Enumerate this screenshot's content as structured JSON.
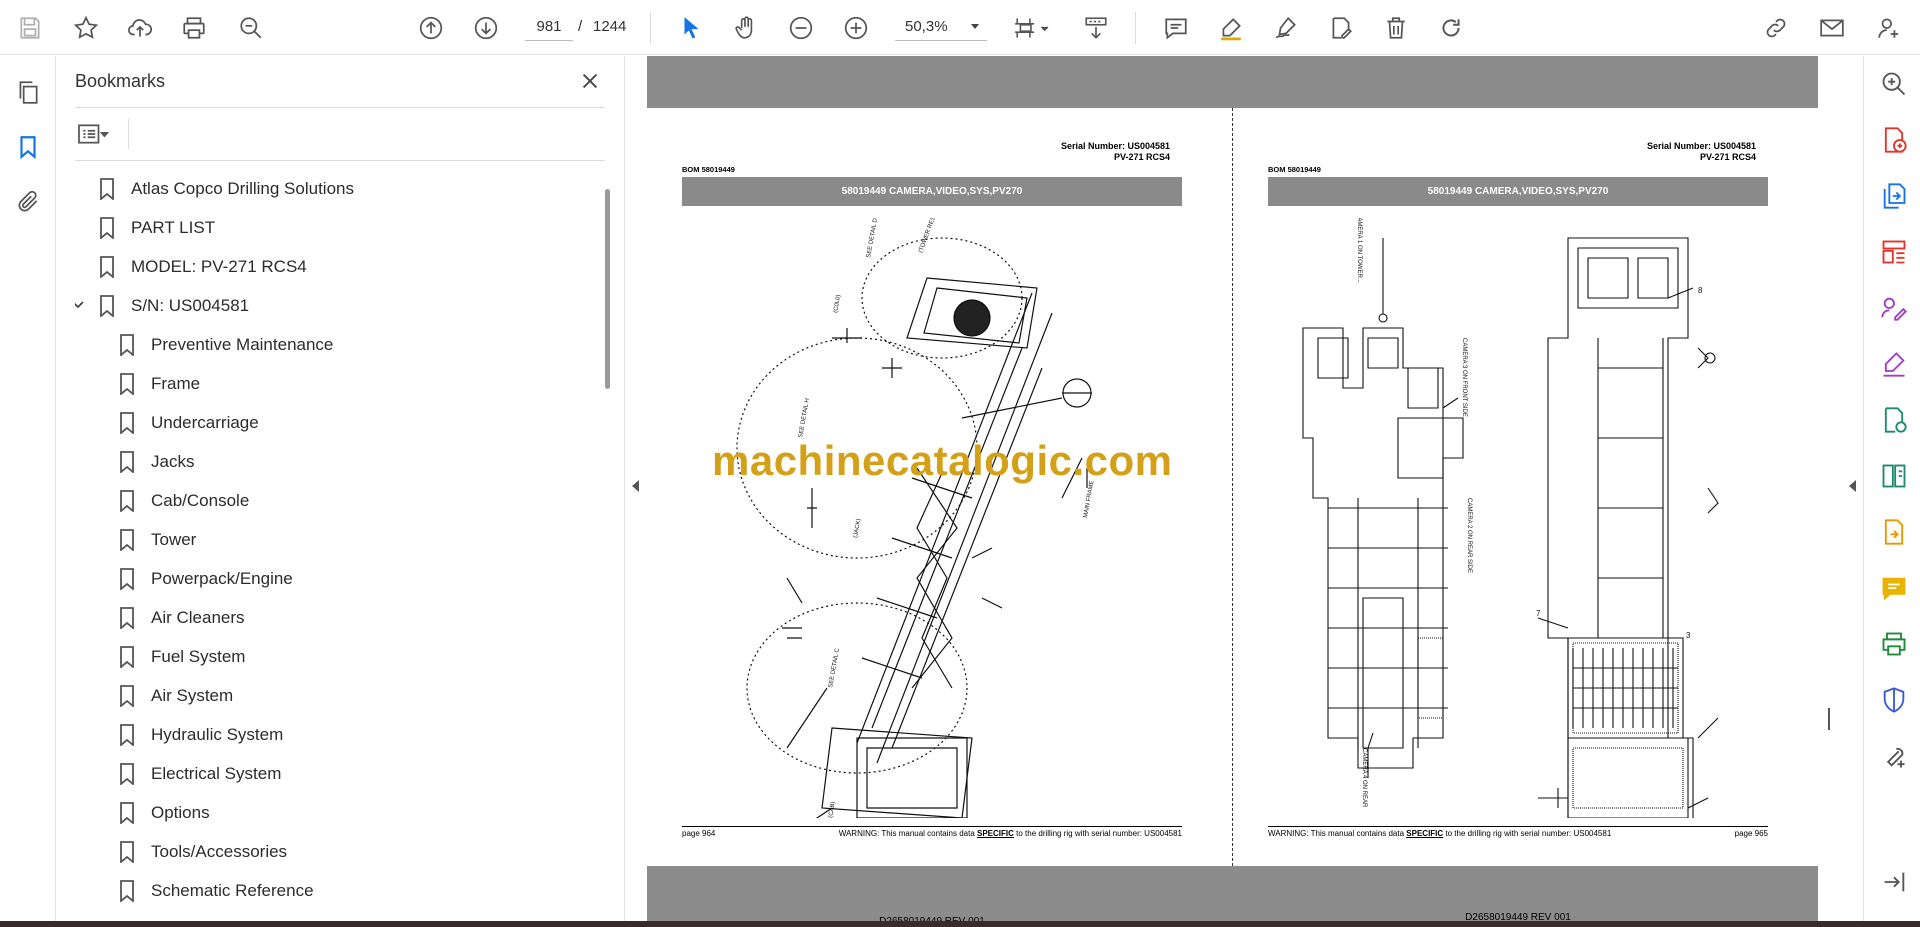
{
  "toolbar": {
    "current_page": "981",
    "page_separator": "/",
    "total_pages": "1244",
    "zoom": "50,3%"
  },
  "bookmarks": {
    "title": "Bookmarks",
    "items": [
      {
        "label": "Atlas Copco Drilling Solutions",
        "level": 0
      },
      {
        "label": "PART LIST",
        "level": 0
      },
      {
        "label": "MODEL: PV-271 RCS4",
        "level": 0
      },
      {
        "label": "S/N: US004581",
        "level": 0,
        "expanded": true
      },
      {
        "label": "Preventive Maintenance",
        "level": 1
      },
      {
        "label": "Frame",
        "level": 1
      },
      {
        "label": "Undercarriage",
        "level": 1
      },
      {
        "label": "Jacks",
        "level": 1
      },
      {
        "label": "Cab/Console",
        "level": 1
      },
      {
        "label": "Tower",
        "level": 1
      },
      {
        "label": "Powerpack/Engine",
        "level": 1
      },
      {
        "label": "Air Cleaners",
        "level": 1
      },
      {
        "label": "Fuel System",
        "level": 1
      },
      {
        "label": "Air System",
        "level": 1
      },
      {
        "label": "Hydraulic System",
        "level": 1
      },
      {
        "label": "Electrical System",
        "level": 1
      },
      {
        "label": "Options",
        "level": 1
      },
      {
        "label": "Tools/Accessories",
        "level": 1
      },
      {
        "label": "Schematic Reference",
        "level": 1
      }
    ]
  },
  "document": {
    "left_page": {
      "serial_line1": "Serial Number: US004581",
      "serial_line2": "PV-271 RCS4",
      "bom": "BOM 58019449",
      "band_title": "58019449 CAMERA,VIDEO,SYS,PV270",
      "drawing_caption": "D2658019449 REV 001",
      "page_label": "page 964",
      "warning_prefix": "WARNING:  This manual contains data ",
      "warning_emph": "SPECIFIC",
      "warning_suffix": " to the drilling rig with serial number: US004581"
    },
    "right_page": {
      "serial_line1": "Serial Number: US004581",
      "serial_line2": "PV-271 RCS4",
      "bom": "BOM 58019449",
      "band_title": "58019449 CAMERA,VIDEO,SYS,PV270",
      "drawing_caption": "D2658019449 REV 001",
      "page_label": "page 965",
      "warning_prefix": "WARNING:  This manual contains data ",
      "warning_emph": "SPECIFIC",
      "warning_suffix": " to the drilling rig with serial number: US004581"
    },
    "watermark": "machinecatalogic.com"
  },
  "colors": {
    "accent_blue": "#1473e6",
    "doc_background": "#8c8c8c",
    "band_gray": "#8a8a8a",
    "watermark": "#d4a017"
  }
}
